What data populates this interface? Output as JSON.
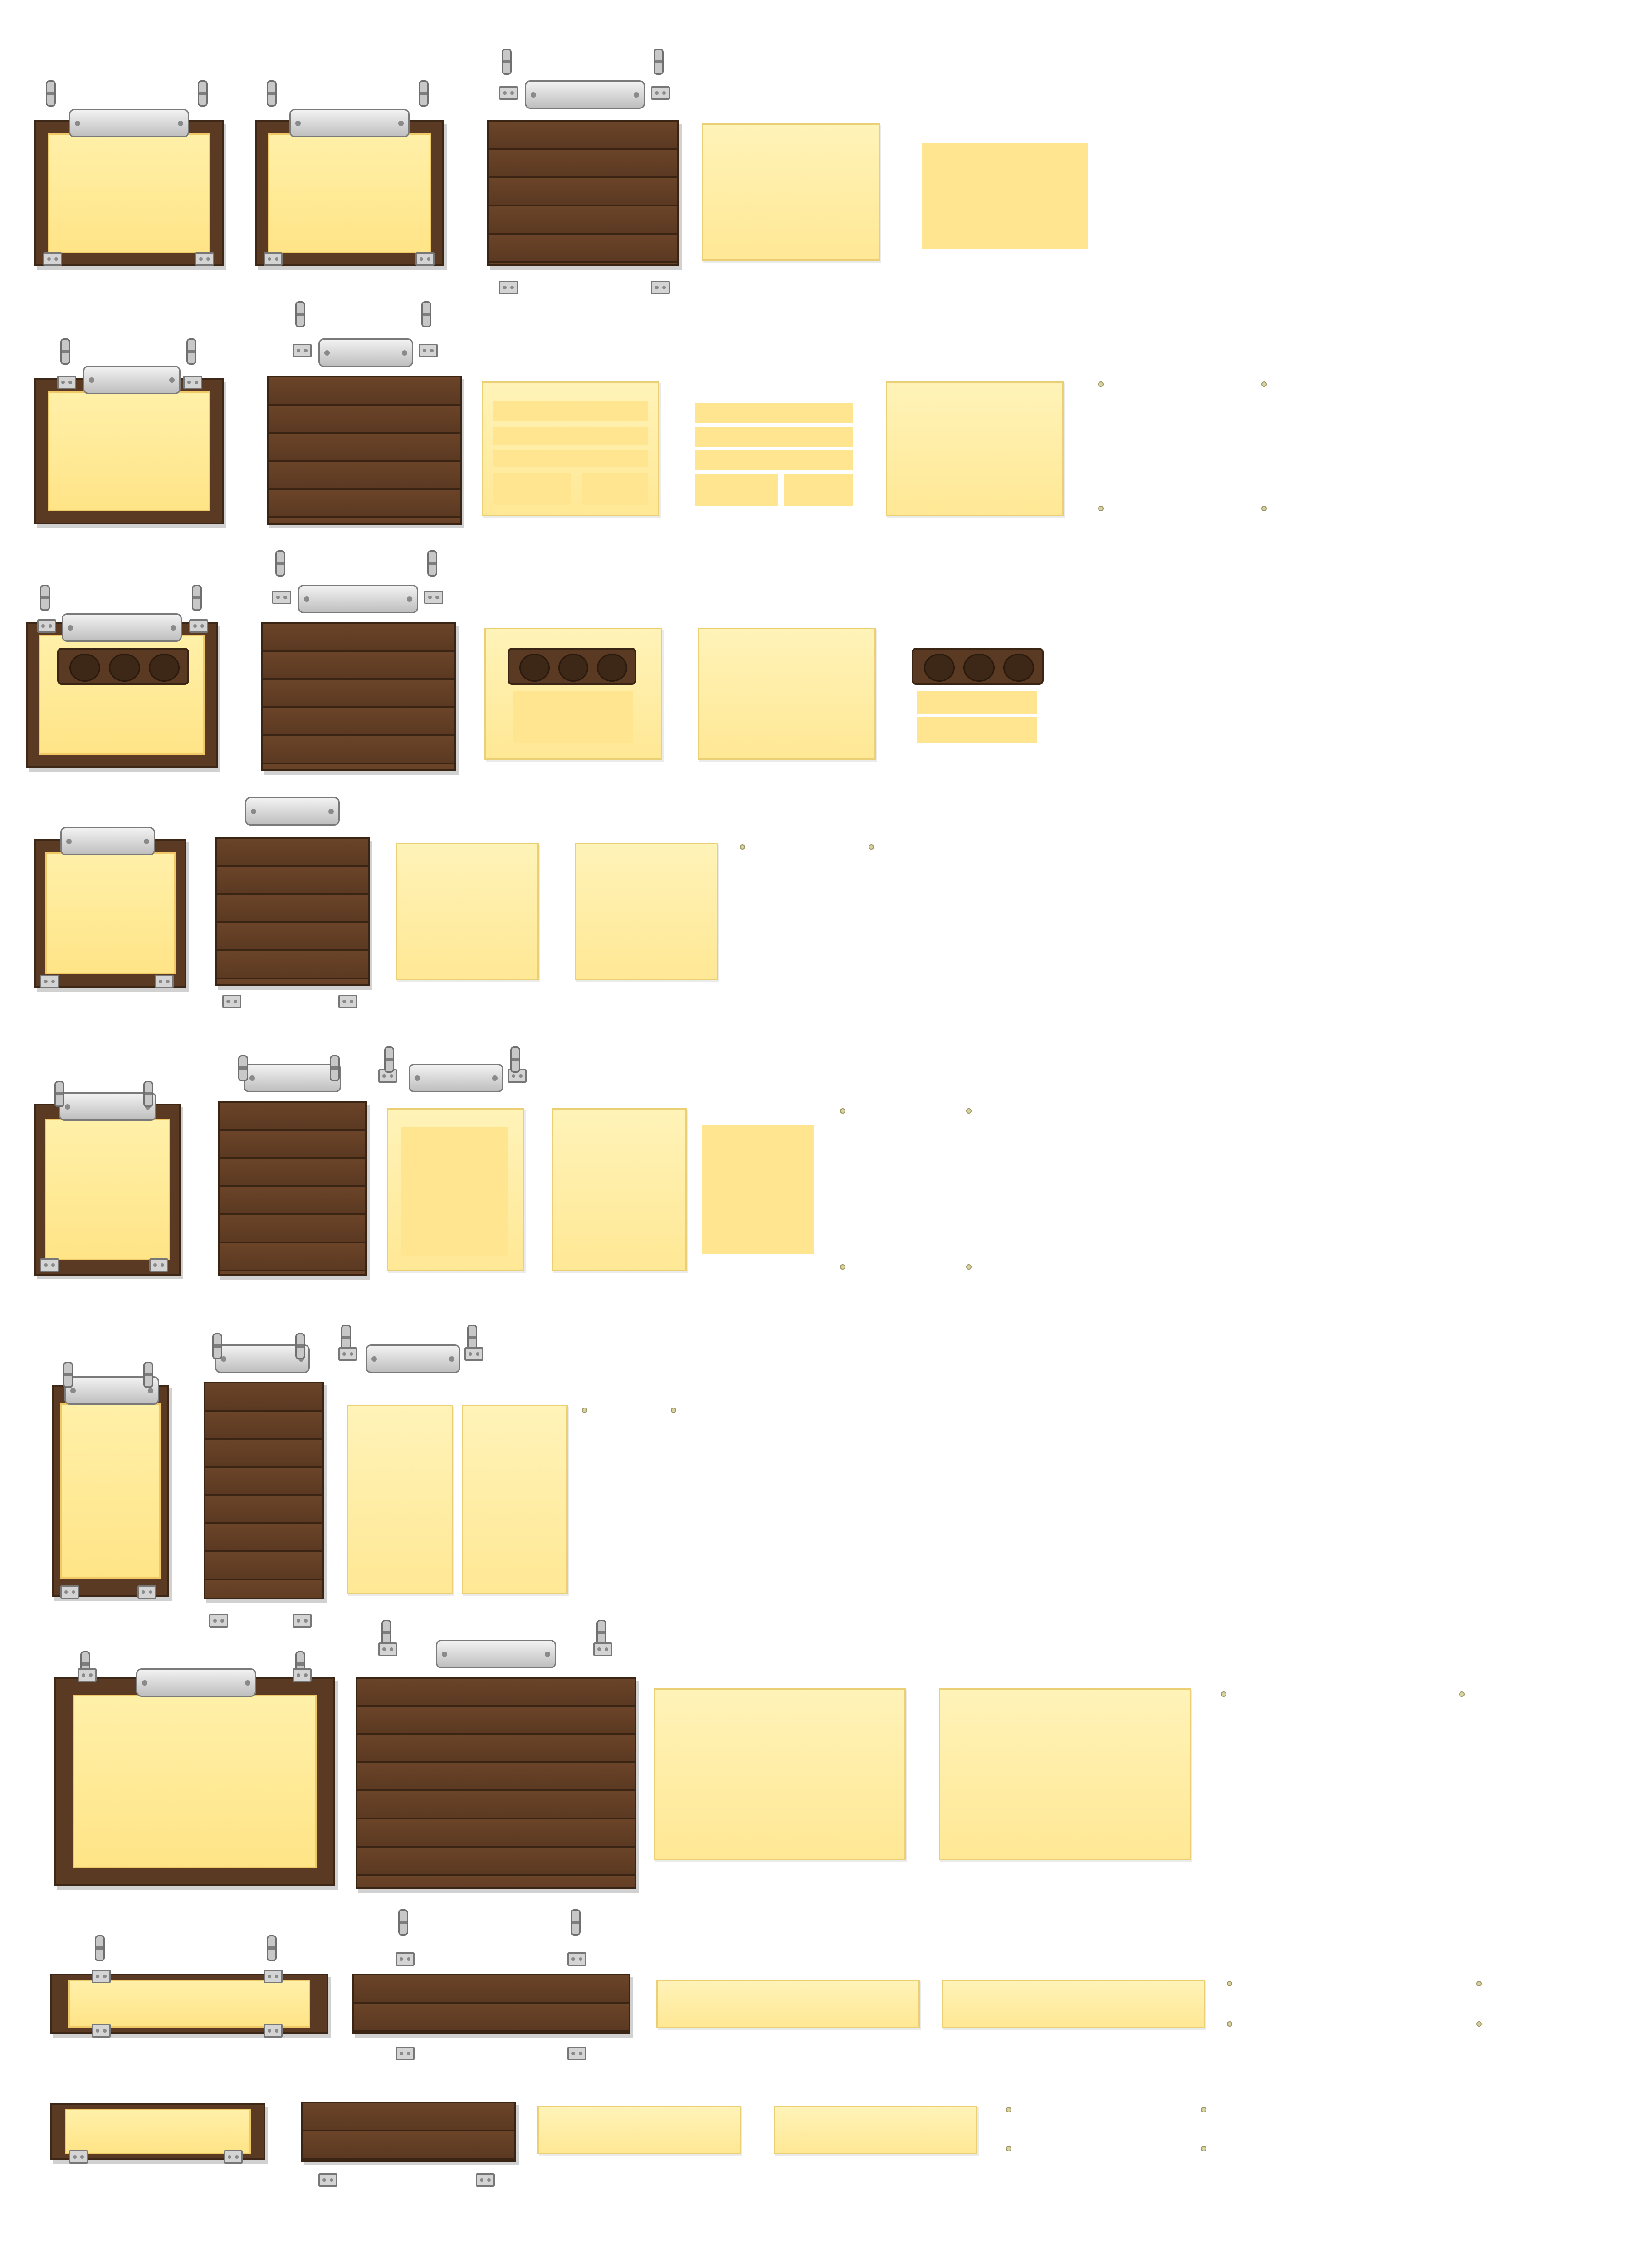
{
  "sheet": {
    "title": "",
    "sprites": [
      "framed-board-chain",
      "wood-plank-back",
      "parchment-loose",
      "parchment-flat",
      "metal-nameplate",
      "chain-link",
      "hinge-bracket",
      "pin",
      "log-holder",
      "paper-strip"
    ]
  },
  "palette": {
    "wood": "#5a3a22",
    "wood_dark": "#3a2414",
    "parchment": "#ffe58f",
    "parchment_light": "#fff3b8",
    "metal": "#d4d4d4",
    "metal_dark": "#777777"
  }
}
